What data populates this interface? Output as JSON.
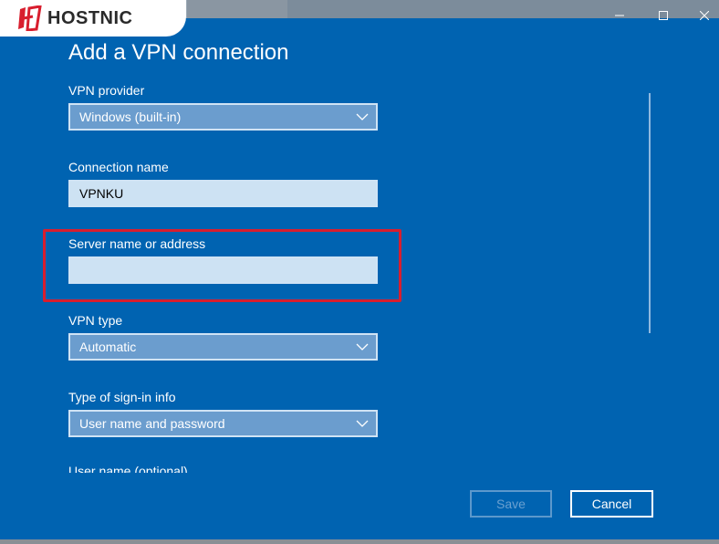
{
  "logo": {
    "text": "HOSTNIC"
  },
  "window": {
    "minimize_icon": "minimize-icon",
    "maximize_icon": "maximize-icon",
    "close_icon": "close-icon"
  },
  "dialog": {
    "title": "Add a VPN connection",
    "fields": {
      "vpn_provider": {
        "label": "VPN provider",
        "value": "Windows (built-in)"
      },
      "connection_name": {
        "label": "Connection name",
        "value": "VPNKU"
      },
      "server": {
        "label": "Server name or address",
        "value": ""
      },
      "vpn_type": {
        "label": "VPN type",
        "value": "Automatic"
      },
      "sign_in_type": {
        "label": "Type of sign-in info",
        "value": "User name and password"
      },
      "username": {
        "label": "User name (optional)"
      }
    },
    "buttons": {
      "save": "Save",
      "cancel": "Cancel"
    }
  },
  "colors": {
    "background": "#0063B1",
    "highlight": "#d81e2e"
  }
}
